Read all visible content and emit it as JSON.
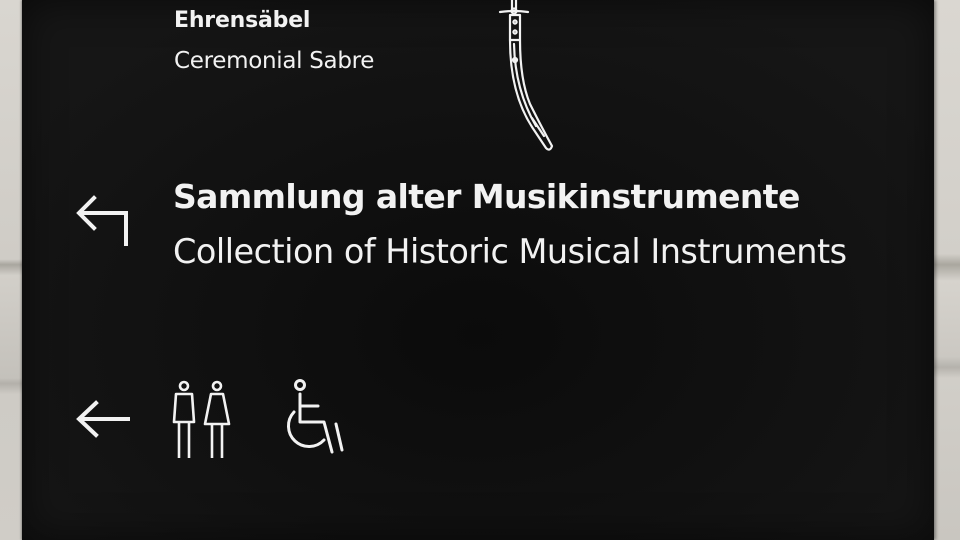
{
  "sign": {
    "top_entry": {
      "label_de": "Ehrensäbel",
      "label_en": "Ceremonial Sabre",
      "pictogram": "sabre-icon"
    },
    "collection_entry": {
      "direction": "arrow-up-left-icon",
      "label_de": "Sammlung alter Musikinstrumente",
      "label_en": "Collection of Historic Musical Instruments"
    },
    "facilities_entry": {
      "direction": "arrow-left-icon",
      "icons": [
        "restroom-man-icon",
        "restroom-woman-icon",
        "wheelchair-icon"
      ]
    },
    "colors": {
      "sign_background": "#111111",
      "text": "#f2f2f2",
      "wall": "#c9c6c0"
    }
  }
}
